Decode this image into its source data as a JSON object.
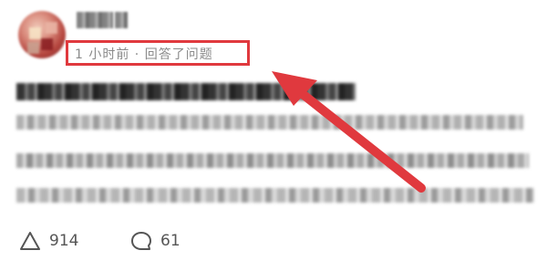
{
  "answer": {
    "meta": "1 小时前 · 回答了问题"
  },
  "actions": {
    "upvote_count": "914",
    "comment_count": "61"
  },
  "colors": {
    "highlight": "#e0393e",
    "meta_text": "#8a8a8a"
  },
  "icons": {
    "upvote": "upvote-triangle-icon",
    "comment": "comment-bubble-icon"
  }
}
